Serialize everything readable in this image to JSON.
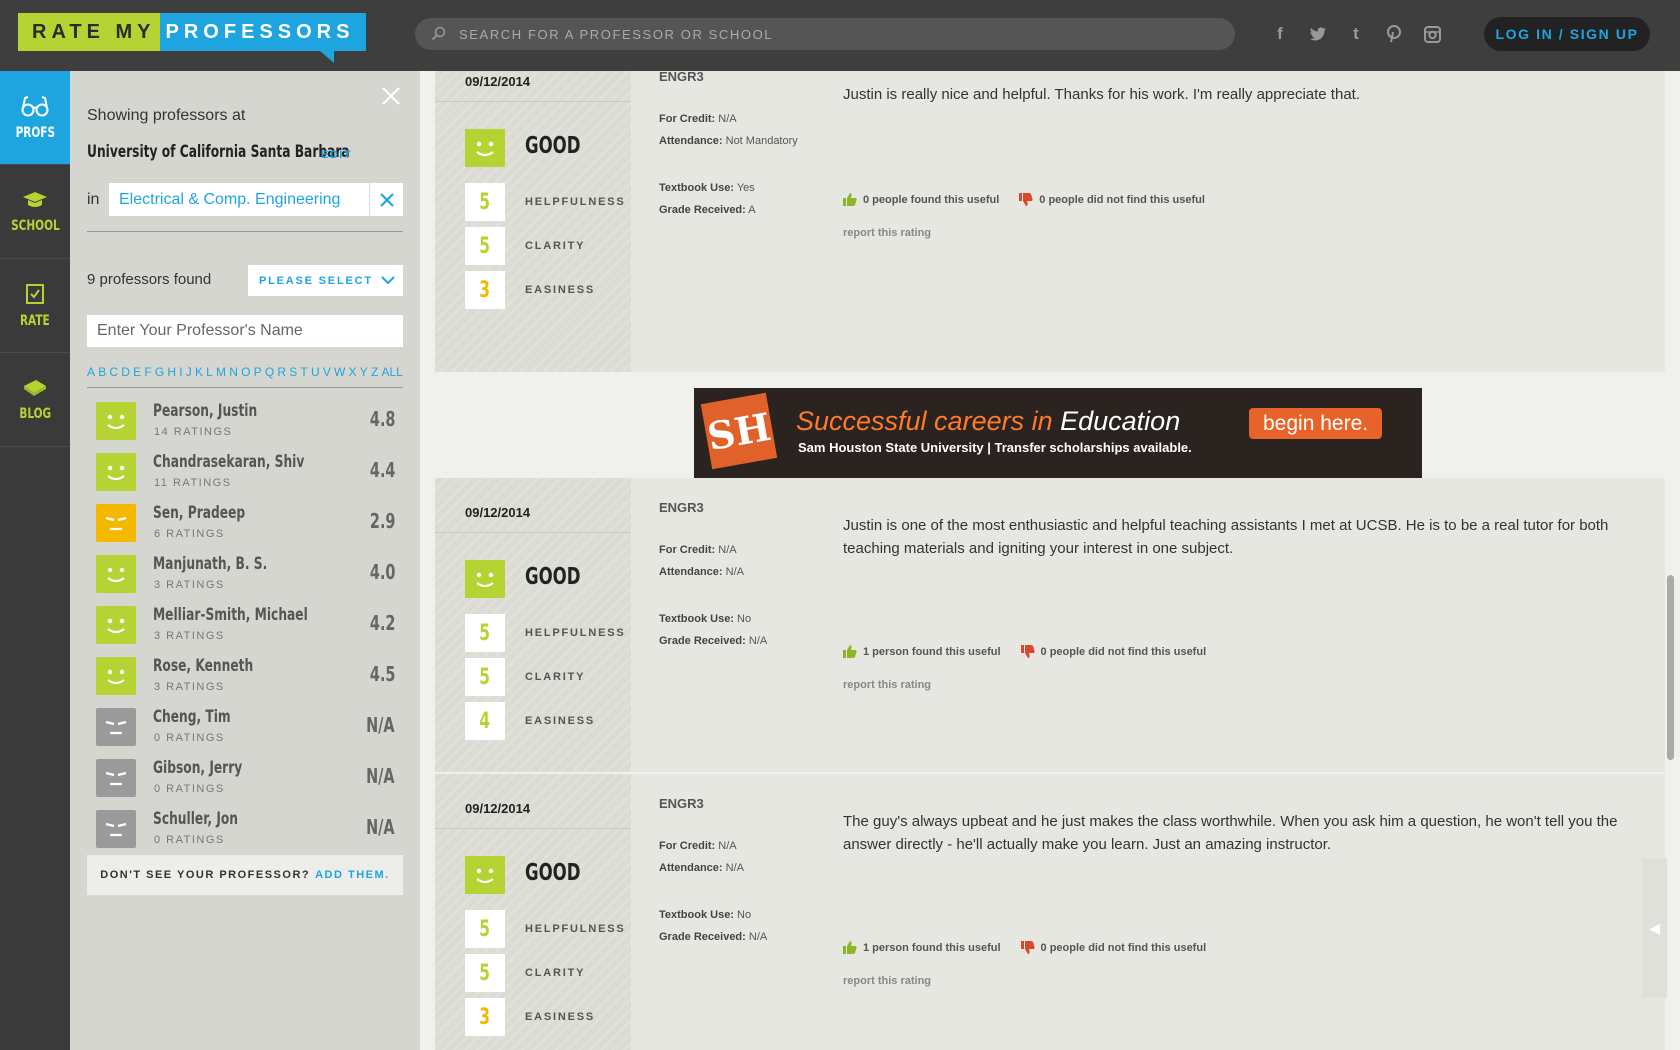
{
  "header": {
    "logo_part1": "RATE MY",
    "logo_part2": "PROFESSORS",
    "search_placeholder": "SEARCH FOR A PROFESSOR OR SCHOOL",
    "login_label": "LOG IN / SIGN UP",
    "social_icons": [
      "facebook-icon",
      "twitter-icon",
      "tumblr-icon",
      "pinterest-icon",
      "instagram-icon"
    ]
  },
  "nav": {
    "items": [
      {
        "label": "PROFS",
        "icon": "glasses-icon",
        "active": true
      },
      {
        "label": "SCHOOL",
        "icon": "graduation-cap-icon",
        "active": false
      },
      {
        "label": "RATE",
        "icon": "checkbox-icon",
        "active": false
      },
      {
        "label": "BLOG",
        "icon": "book-icon",
        "active": false
      }
    ]
  },
  "sidebar": {
    "showing_label": "Showing professors at",
    "school": "University of California Santa Barbara",
    "edit_label": "EDIT",
    "in_label": "in",
    "department": "Electrical & Comp. Engineering",
    "found_label": "9 professors found",
    "select_label": "PLEASE SELECT",
    "name_placeholder": "Enter Your Professor's Name",
    "alphabet": [
      "A",
      "B",
      "C",
      "D",
      "E",
      "F",
      "G",
      "H",
      "I",
      "J",
      "K",
      "L",
      "M",
      "N",
      "O",
      "P",
      "Q",
      "R",
      "S",
      "T",
      "U",
      "V",
      "W",
      "X",
      "Y",
      "Z",
      "ALL"
    ],
    "professors": [
      {
        "name": "Pearson, Justin",
        "ratings": "14 RATINGS",
        "score": "4.8",
        "mood": "good"
      },
      {
        "name": "Chandrasekaran, Shiv",
        "ratings": "11 RATINGS",
        "score": "4.4",
        "mood": "good"
      },
      {
        "name": "Sen, Pradeep",
        "ratings": "6 RATINGS",
        "score": "2.9",
        "mood": "average"
      },
      {
        "name": "Manjunath, B. S.",
        "ratings": "3 RATINGS",
        "score": "4.0",
        "mood": "good"
      },
      {
        "name": "Melliar-Smith, Michael",
        "ratings": "3 RATINGS",
        "score": "4.2",
        "mood": "good"
      },
      {
        "name": "Rose, Kenneth",
        "ratings": "3 RATINGS",
        "score": "4.5",
        "mood": "good"
      },
      {
        "name": "Cheng, Tim",
        "ratings": "0 RATINGS",
        "score": "N/A",
        "mood": "none"
      },
      {
        "name": "Gibson, Jerry",
        "ratings": "0 RATINGS",
        "score": "N/A",
        "mood": "none"
      },
      {
        "name": "Schuller, Jon",
        "ratings": "0 RATINGS",
        "score": "N/A",
        "mood": "none"
      }
    ],
    "dont_see": "DON'T SEE YOUR PROFESSOR?",
    "add_them": "ADD THEM."
  },
  "ratings": [
    {
      "date": "09/12/2014",
      "quality": "GOOD",
      "helpfulness": "5",
      "clarity": "5",
      "easiness": "3",
      "course": "ENGR3",
      "for_credit_label": "For Credit:",
      "for_credit": "N/A",
      "attendance_label": "Attendance:",
      "attendance": "Not Mandatory",
      "textbook_label": "Textbook Use:",
      "textbook": "Yes",
      "grade_label": "Grade Received:",
      "grade": "A",
      "comment": "Justin is really nice and helpful. Thanks for his work. I'm really appreciate that.",
      "useful": "0 people found this useful",
      "not_useful": "0 people did not find this useful",
      "report": "report this rating"
    },
    {
      "date": "09/12/2014",
      "quality": "GOOD",
      "helpfulness": "5",
      "clarity": "5",
      "easiness": "4",
      "course": "ENGR3",
      "for_credit_label": "For Credit:",
      "for_credit": "N/A",
      "attendance_label": "Attendance:",
      "attendance": "N/A",
      "textbook_label": "Textbook Use:",
      "textbook": "No",
      "grade_label": "Grade Received:",
      "grade": "N/A",
      "comment": "Justin is one of the most enthusiastic and helpful teaching assistants I met at UCSB. He is to be a real tutor for both teaching materials and igniting your interest in one subject.",
      "useful": "1 person found this useful",
      "not_useful": "0 people did not find this useful",
      "report": "report this rating"
    },
    {
      "date": "09/12/2014",
      "quality": "GOOD",
      "helpfulness": "5",
      "clarity": "5",
      "easiness": "3",
      "course": "ENGR3",
      "for_credit_label": "For Credit:",
      "for_credit": "N/A",
      "attendance_label": "Attendance:",
      "attendance": "N/A",
      "textbook_label": "Textbook Use:",
      "textbook": "No",
      "grade_label": "Grade Received:",
      "grade": "N/A",
      "comment": "The guy's always upbeat and he just makes the class worthwhile. When you ask him a question, he won't tell you the answer directly - he'll actually make you learn. Just an amazing instructor.",
      "useful": "1 person found this useful",
      "not_useful": "0 people did not find this useful",
      "report": "report this rating"
    }
  ],
  "score_labels": {
    "helpfulness": "HELPFULNESS",
    "clarity": "CLARITY",
    "easiness": "EASINESS"
  },
  "ad": {
    "line1_a": "Successful careers in",
    "line1_b": "Education",
    "cta": "begin here.",
    "line2": "Sam Houston State University  |  Transfer scholarships available.",
    "logo_text": "SH"
  },
  "colors": {
    "accent_blue": "#1ea5e0",
    "good_green": "#b6d334",
    "average_yellow": "#f5b800",
    "none_gray": "#9a9a9a"
  }
}
